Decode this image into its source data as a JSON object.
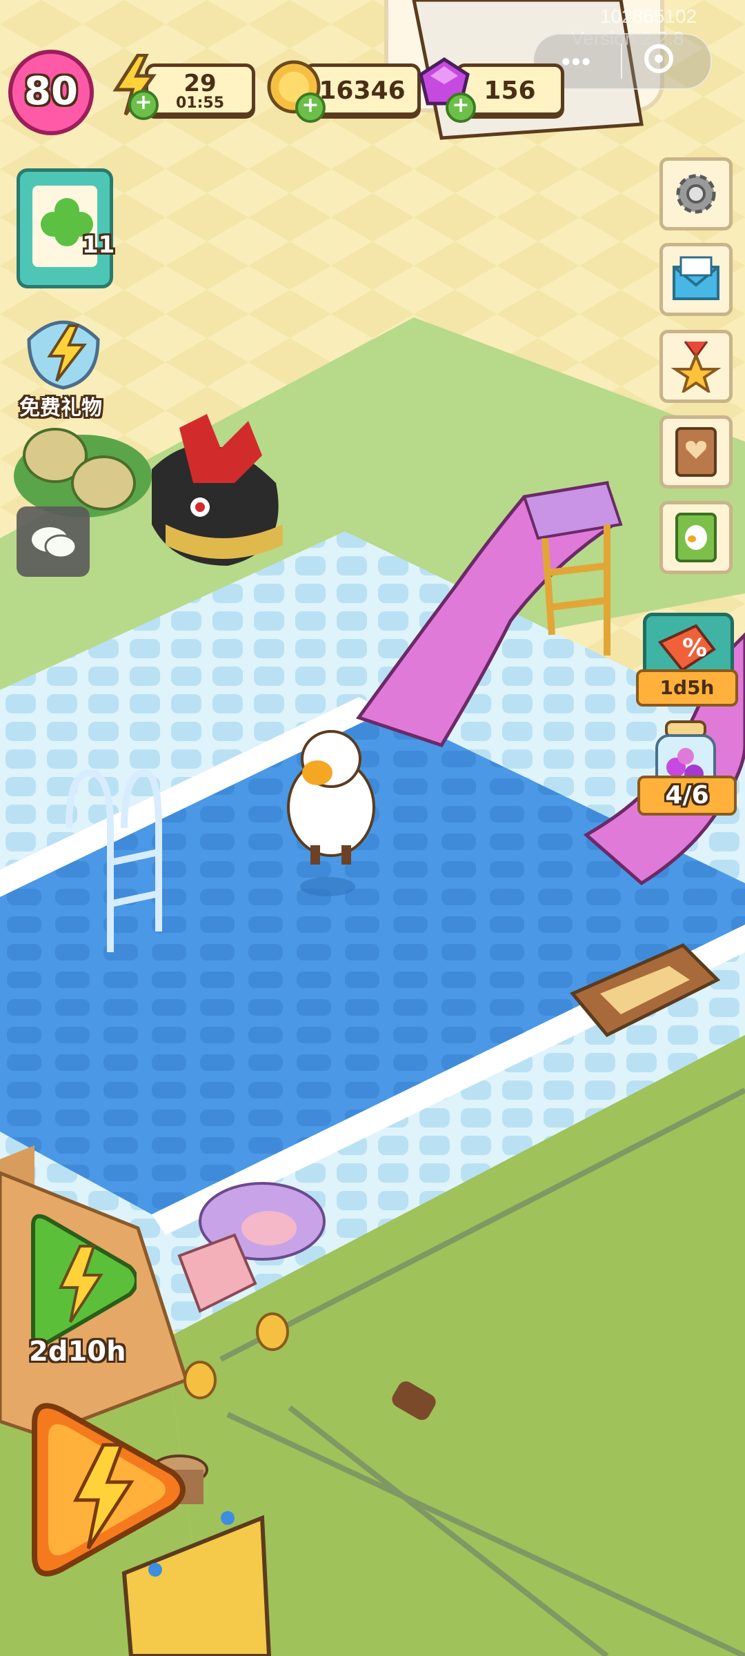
{
  "colors": {
    "floor": "#f6e9b5",
    "grass": "#9fc25a",
    "pool_water": "#3d8ee0",
    "pool_deck": "#cdeaf6",
    "slide": "#e07ad8",
    "accent_orange": "#ffb13b"
  },
  "hud": {
    "level": "80",
    "energy_count": "29",
    "energy_timer": "01:55",
    "coins": "16346",
    "gems": "156",
    "overlay_id": "102865102",
    "version": "Version 2.2.8"
  },
  "left_panel": {
    "task_count": "11",
    "free_gift_label": "免费礼物"
  },
  "right_panel": {
    "sale_timer": "1d5h",
    "jar_progress": "4/6"
  },
  "bottom": {
    "event_timer": "2d10h"
  },
  "icons": [
    "level-badge-icon",
    "energy-bolt-icon",
    "coin-icon",
    "gem-icon",
    "gear-icon",
    "mail-icon",
    "medal-star-icon",
    "heart-book-icon",
    "bird-book-icon",
    "chat-bubble-icon",
    "clover-clipboard-icon",
    "gift-trophy-icon",
    "discount-tag-icon",
    "candy-jar-icon",
    "lightning-play-icon"
  ]
}
